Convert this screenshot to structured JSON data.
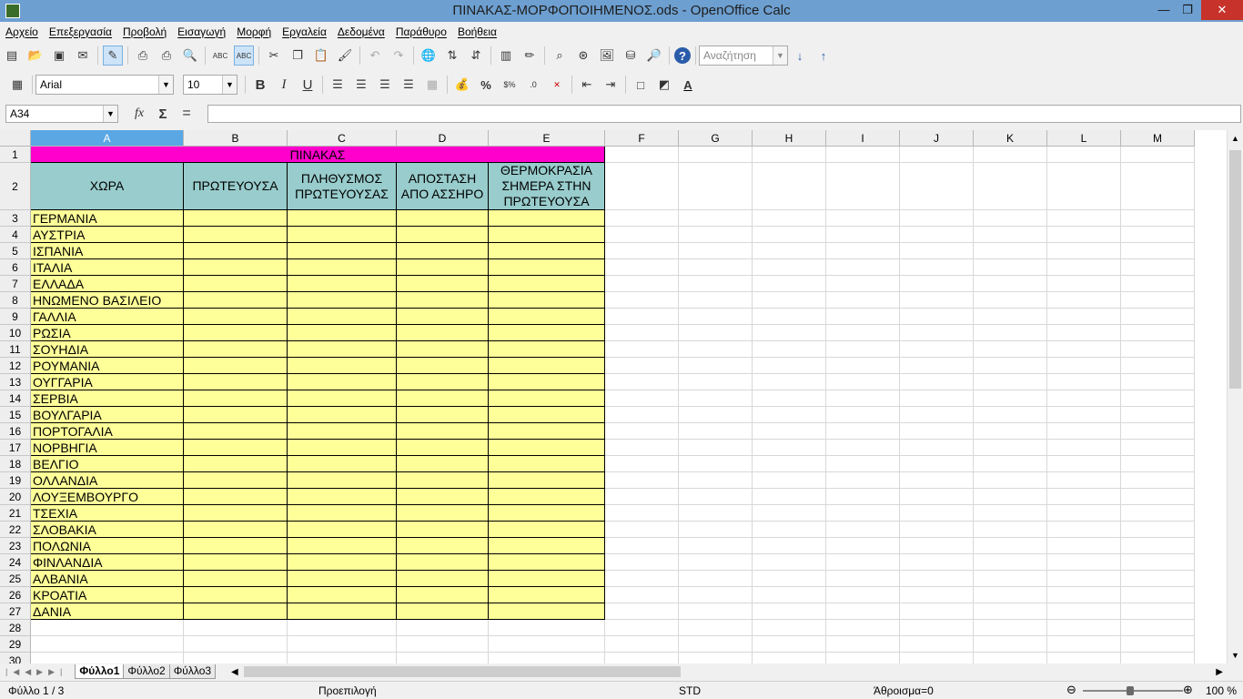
{
  "window": {
    "title": "ΠΙΝΑΚΑΣ-ΜΟΡΦΟΠΟΙΗΜΕΝΟΣ.ods - OpenOffice Calc",
    "minimize": "—",
    "restore": "❐",
    "close": "✕"
  },
  "menu": [
    "Αρχείο",
    "Επεξεργασία",
    "Προβολή",
    "Εισαγωγή",
    "Μορφή",
    "Εργαλεία",
    "Δεδομένα",
    "Παράθυρο",
    "Βοήθεια"
  ],
  "toolbar": {
    "search_placeholder": "Αναζήτηση",
    "font_name": "Arial",
    "font_size": "10",
    "bold": "B",
    "italic": "I",
    "underline": "U",
    "percent": "%"
  },
  "formula": {
    "cell_ref": "A34",
    "value": "",
    "fx": "fx",
    "sum": "Σ",
    "equals": "="
  },
  "columns": [
    "A",
    "B",
    "C",
    "D",
    "E",
    "F",
    "G",
    "H",
    "I",
    "J",
    "K",
    "L",
    "M"
  ],
  "sheet": {
    "title": "ΠΙΝΑΚΑΣ",
    "headers": [
      "ΧΩΡΑ",
      "ΠΡΩΤΕΥΟΥΣΑ",
      "ΠΛΗΘΥΣΜΟΣ ΠΡΩΤΕΥΟΥΣΑΣ",
      "ΑΠΟΣΤΑΣΗ ΑΠΟ ΑΣΣΗΡΟ",
      "ΘΕΡΜΟΚΡΑΣΙΑ ΣΗΜΕΡΑ ΣΤΗΝ ΠΡΩΤΕΥΟΥΣΑ"
    ],
    "countries": [
      "ΓΕΡΜΑΝΙΑ",
      "ΑΥΣΤΡΙΑ",
      "ΙΣΠΑΝΙΑ",
      "ΙΤΑΛΙΑ",
      "ΕΛΛΑΔΑ",
      "ΗΝΩΜΕΝΟ ΒΑΣΙΛΕΙΟ",
      "ΓΑΛΛΙΑ",
      "ΡΩΣΙΑ",
      "ΣΟΥΗΔΙΑ",
      "ΡΟΥΜΑΝΙΑ",
      "ΟΥΓΓΑΡΙΑ",
      "ΣΕΡΒΙΑ",
      "ΒΟΥΛΓΑΡΙΑ",
      "ΠΟΡΤΟΓΑΛΙΑ",
      "ΝΟΡΒΗΓΙΑ",
      "ΒΕΛΓΙΟ",
      "ΟΛΛΑΝΔΙΑ",
      "ΛΟΥΞΕΜΒΟΥΡΓΟ",
      "ΤΣΕΧΙΑ",
      "ΣΛΟΒΑΚΙΑ",
      "ΠΟΛΩΝΙΑ",
      "ΦΙΝΛΑΝΔΙΑ",
      "ΑΛΒΑΝΙΑ",
      "ΚΡΟΑΤΙΑ",
      "ΔΑΝΙΑ"
    ]
  },
  "rows": [
    "1",
    "2",
    "3",
    "4",
    "5",
    "6",
    "7",
    "8",
    "9",
    "10",
    "11",
    "12",
    "13",
    "14",
    "15",
    "16",
    "17",
    "18",
    "19",
    "20",
    "21",
    "22",
    "23",
    "24",
    "25",
    "26",
    "27",
    "28",
    "29",
    "30"
  ],
  "tabs": [
    "Φύλλο1",
    "Φύλλο2",
    "Φύλλο3"
  ],
  "status": {
    "sheet": "Φύλλο 1 / 3",
    "style": "Προεπιλογή",
    "mode": "STD",
    "sum": "Άθροισμα=0",
    "zoom": "100 %"
  },
  "colors": {
    "title_fill": "#ff00cc",
    "header_fill": "#99cccc",
    "data_fill": "#ffff99",
    "selected_col": "#5aa7e4"
  }
}
